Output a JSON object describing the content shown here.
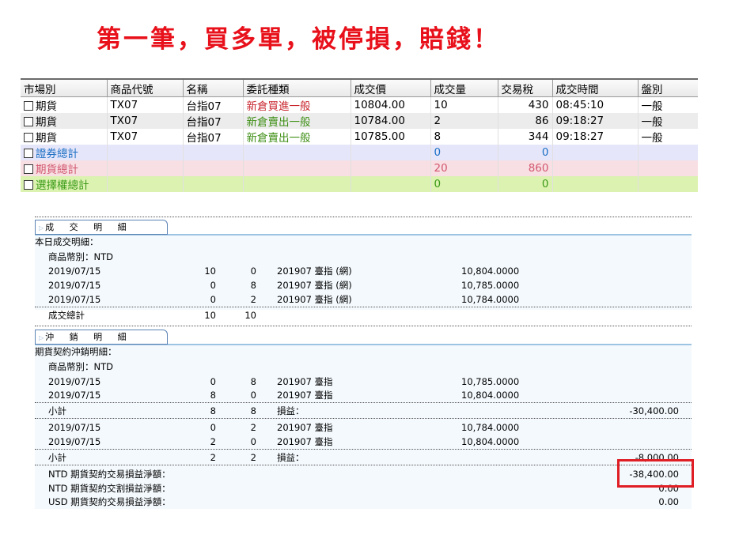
{
  "banner": "第一筆，買多單，被停損，賠錢！",
  "grid": {
    "headers": [
      "市場別",
      "商品代號",
      "名稱",
      "委託種類",
      "成交價",
      "成交量",
      "交易稅",
      "成交時間",
      "盤別"
    ],
    "rows": [
      {
        "market": "期貨",
        "code": "TX07",
        "name": "台指07",
        "type": "新倉買進一般",
        "price": "10804.00",
        "qty": "10",
        "tax": "430",
        "time": "08:45:10",
        "session": "一般"
      },
      {
        "market": "期貨",
        "code": "TX07",
        "name": "台指07",
        "type": "新倉賣出一般",
        "price": "10784.00",
        "qty": "2",
        "tax": "86",
        "time": "09:18:27",
        "session": "一般"
      },
      {
        "market": "期貨",
        "code": "TX07",
        "name": "台指07",
        "type": "新倉賣出一般",
        "price": "10785.00",
        "qty": "8",
        "tax": "344",
        "time": "09:18:27",
        "session": "一般"
      }
    ],
    "totals": {
      "securities": {
        "label": "證券總計",
        "qty": "0",
        "tax": "0"
      },
      "futures": {
        "label": "期貨總計",
        "qty": "20",
        "tax": "860"
      },
      "options": {
        "label": "選擇權總計",
        "qty": "0",
        "tax": "0"
      }
    }
  },
  "trade_detail": {
    "tab_label": "成 交 明 細",
    "title": "本日成交明細：",
    "currency_line": "商品幣別：NTD",
    "rows": [
      {
        "date": "2019/07/15",
        "buy": "10",
        "sell": "0",
        "product": "201907 臺指 (網)",
        "price": "10,804.0000"
      },
      {
        "date": "2019/07/15",
        "buy": "0",
        "sell": "8",
        "product": "201907 臺指 (網)",
        "price": "10,785.0000"
      },
      {
        "date": "2019/07/15",
        "buy": "0",
        "sell": "2",
        "product": "201907 臺指 (網)",
        "price": "10,784.0000"
      }
    ],
    "total": {
      "label": "成交總計",
      "buy": "10",
      "sell": "10"
    }
  },
  "offset_detail": {
    "tab_label": "沖 銷 明 細",
    "title": "期貨契約沖銷明細：",
    "currency_line": "商品幣別：NTD",
    "group1": [
      {
        "date": "2019/07/15",
        "buy": "0",
        "sell": "8",
        "product": "201907 臺指",
        "price": "10,785.0000"
      },
      {
        "date": "2019/07/15",
        "buy": "8",
        "sell": "0",
        "product": "201907 臺指",
        "price": "10,804.0000"
      }
    ],
    "subtotal1": {
      "label": "小計",
      "buy": "8",
      "sell": "8",
      "pl_label": "損益：",
      "pl": "-30,400.00"
    },
    "group2": [
      {
        "date": "2019/07/15",
        "buy": "0",
        "sell": "2",
        "product": "201907 臺指",
        "price": "10,784.0000"
      },
      {
        "date": "2019/07/15",
        "buy": "2",
        "sell": "0",
        "product": "201907 臺指",
        "price": "10,804.0000"
      }
    ],
    "subtotal2": {
      "label": "小計",
      "buy": "2",
      "sell": "2",
      "pl_label": "損益：",
      "pl": "-8,000.00"
    },
    "net": [
      {
        "label": "NTD 期貨契約交易損益淨額：",
        "value": "-38,400.00"
      },
      {
        "label": "NTD 期貨契約交割損益淨額：",
        "value": "0.00"
      },
      {
        "label": "USD 期貨契約交易損益淨額：",
        "value": "0.00"
      }
    ]
  },
  "colors": {
    "banner": "#e8101a",
    "highlight_box": "#e01e25",
    "buy_type": "#c8262e",
    "sell_type": "#3f8f16"
  }
}
